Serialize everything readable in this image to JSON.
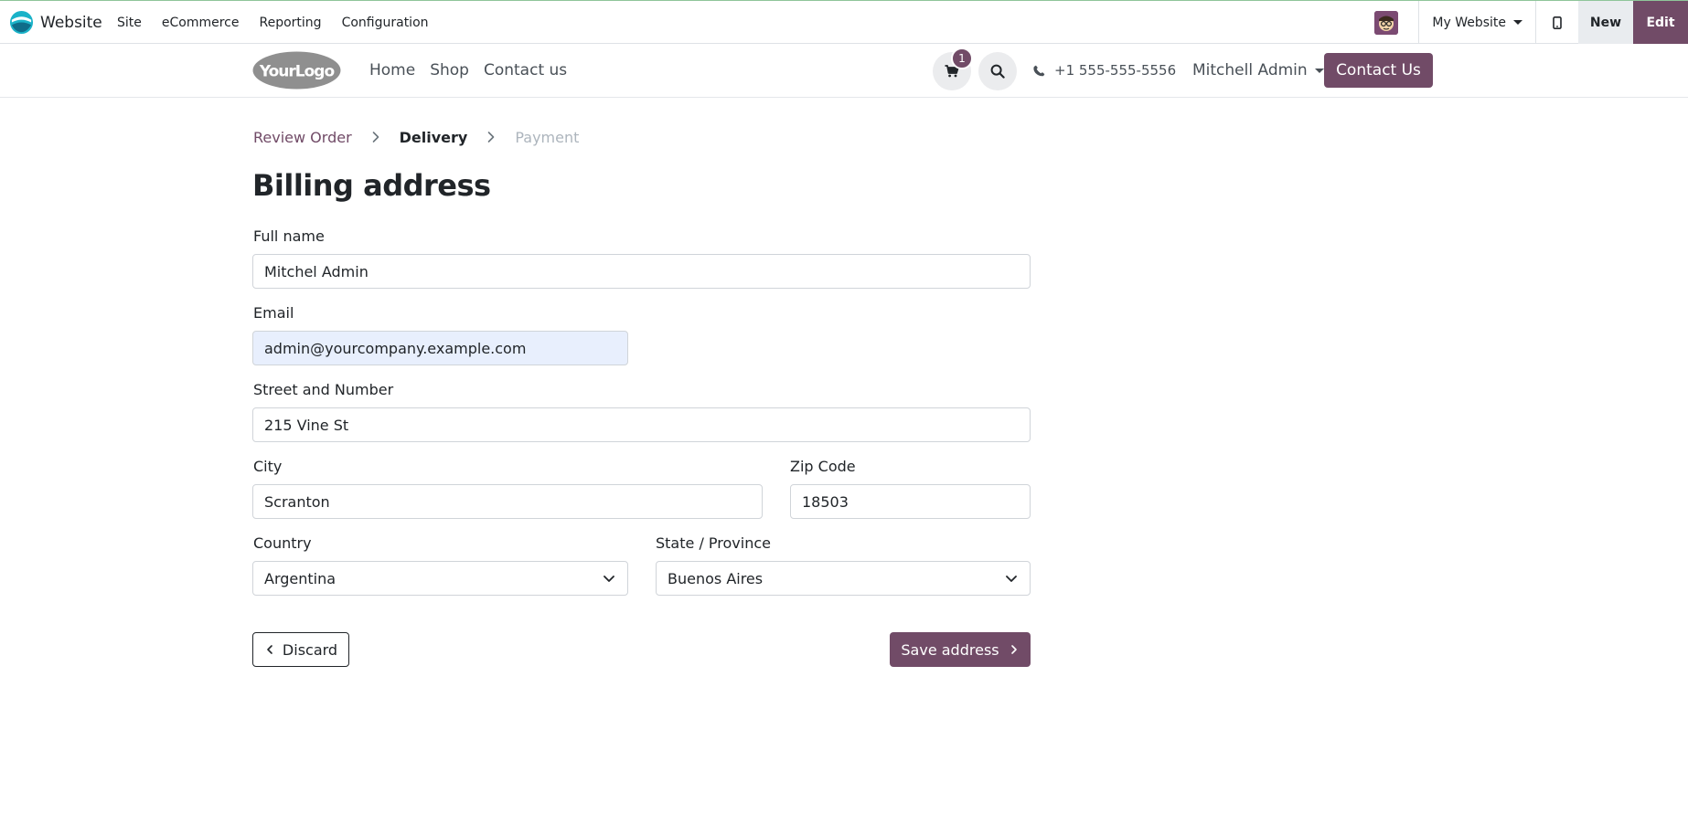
{
  "admin_bar": {
    "app_name": "Website",
    "menu": [
      "Site",
      "eCommerce",
      "Reporting",
      "Configuration"
    ],
    "website_switcher": "My Website",
    "new_label": "New",
    "edit_label": "Edit"
  },
  "header": {
    "logo_text": "YourLogo",
    "nav": [
      "Home",
      "Shop",
      "Contact us"
    ],
    "cart_count": "1",
    "phone": "+1 555-555-5556",
    "user": "Mitchell Admin",
    "contact_button": "Contact Us"
  },
  "breadcrumb": {
    "review": "Review Order",
    "delivery": "Delivery",
    "payment": "Payment"
  },
  "form": {
    "title": "Billing address",
    "full_name": {
      "label": "Full name",
      "value": "Mitchel Admin"
    },
    "email": {
      "label": "Email",
      "value": "admin@yourcompany.example.com"
    },
    "street": {
      "label": "Street and Number",
      "value": "215 Vine St"
    },
    "city": {
      "label": "City",
      "value": "Scranton"
    },
    "zip": {
      "label": "Zip Code",
      "value": "18503"
    },
    "country": {
      "label": "Country",
      "value": "Argentina"
    },
    "state": {
      "label": "State / Province",
      "value": "Buenos Aires"
    },
    "discard_label": "Discard",
    "save_label": "Save address"
  },
  "colors": {
    "primary": "#714b67",
    "autofill": "#e8effd"
  }
}
